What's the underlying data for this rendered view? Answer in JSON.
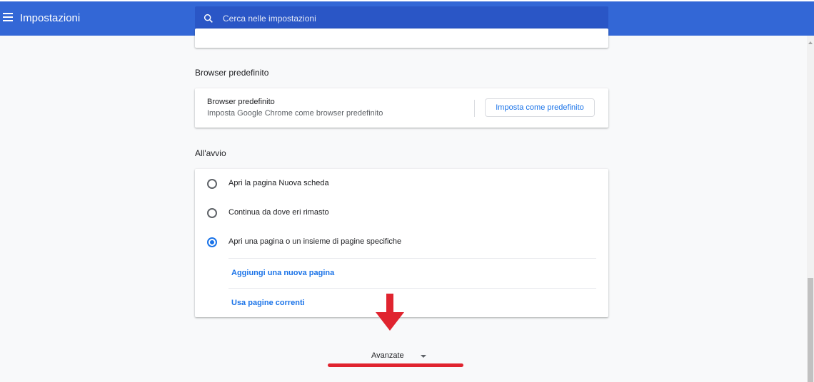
{
  "header": {
    "title": "Impostazioni",
    "search_placeholder": "Cerca nelle impostazioni",
    "menu_icon": "hamburger-menu-icon",
    "search_icon": "search-icon"
  },
  "default_browser": {
    "section_title": "Browser predefinito",
    "row_title": "Browser predefinito",
    "row_subtitle": "Imposta Google Chrome come browser predefinito",
    "button_label": "Imposta come predefinito"
  },
  "startup": {
    "section_title": "All'avvio",
    "options": [
      {
        "label": "Apri la pagina Nuova scheda",
        "checked": false
      },
      {
        "label": "Continua da dove eri rimasto",
        "checked": false
      },
      {
        "label": "Apri una pagina o un insieme di pagine specifiche",
        "checked": true
      }
    ],
    "add_page_link": "Aggiungi una nuova pagina",
    "use_current_link": "Usa pagine correnti"
  },
  "advanced": {
    "label": "Avanzate",
    "icon": "chevron-down-icon"
  },
  "colors": {
    "header_bg": "#3367d6",
    "search_bg": "#2a56c6",
    "accent": "#1a73e8",
    "annotation": "#e0242f"
  }
}
